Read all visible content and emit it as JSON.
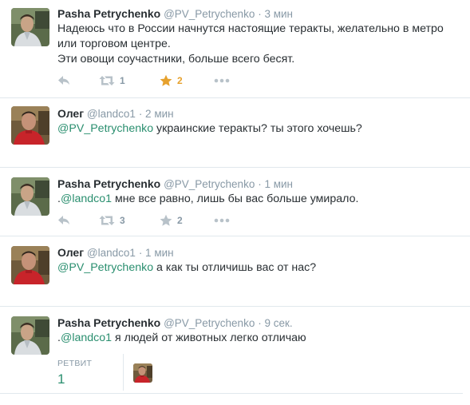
{
  "tweets": [
    {
      "name": "Pasha Petrychenko",
      "handle": "@PV_Petrychenko",
      "time": "· 3 мин",
      "lines": [
        "Надеюсь что в России начнутся настоящие теракты, желательно в метро",
        "или торговом центре.",
        "Эти овощи соучастники, больше всего бесят."
      ],
      "retweets": "1",
      "favorites": "2"
    },
    {
      "name": "Олег",
      "handle": "@landco1",
      "time": "· 2 мин",
      "mention": "@PV_Petrychenko",
      "text": " украинские теракты? ты этого хочешь?"
    },
    {
      "name": "Pasha Petrychenko",
      "handle": "@PV_Petrychenko",
      "time": "· 1 мин",
      "prefix": ".",
      "mention": "@landco1",
      "text": " мне все равно, лишь бы вас больше умирало.",
      "retweets": "3",
      "favorites": "2"
    },
    {
      "name": "Олег",
      "handle": "@landco1",
      "time": "· 1 мин",
      "mention": "@PV_Petrychenko",
      "text": " а как ты отличишь вас от нас?"
    },
    {
      "name": "Pasha Petrychenko",
      "handle": "@PV_Petrychenko",
      "time": "· 9 сек.",
      "prefix": ".",
      "mention": "@landco1",
      "text": " я людей от животных легко отличаю",
      "stat_label": "РЕТВИТ",
      "stat_value": "1"
    }
  ],
  "icons": {
    "reply": "reply-icon",
    "retweet": "retweet-icon",
    "favorite": "star-icon",
    "more": "more-icon"
  },
  "colors": {
    "link": "#2a8f6f",
    "favorited": "#e6a12d",
    "icon": "#b8c2c9",
    "muted": "#8899a6",
    "divider": "#e1e8ed"
  }
}
